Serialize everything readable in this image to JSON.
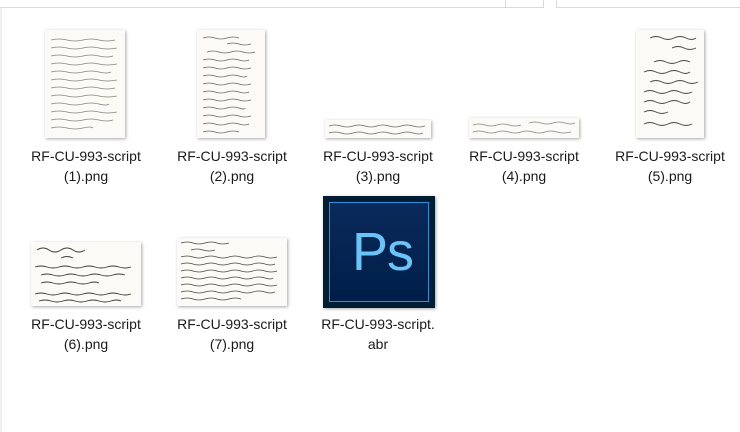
{
  "files": [
    {
      "line1": "RF-CU-993-script",
      "line2": "(1).png",
      "kind": "png"
    },
    {
      "line1": "RF-CU-993-script",
      "line2": "(2).png",
      "kind": "png"
    },
    {
      "line1": "RF-CU-993-script",
      "line2": "(3).png",
      "kind": "png"
    },
    {
      "line1": "RF-CU-993-script",
      "line2": "(4).png",
      "kind": "png"
    },
    {
      "line1": "RF-CU-993-script",
      "line2": "(5).png",
      "kind": "png"
    },
    {
      "line1": "RF-CU-993-script",
      "line2": "(6).png",
      "kind": "png"
    },
    {
      "line1": "RF-CU-993-script",
      "line2": "(7).png",
      "kind": "png"
    },
    {
      "line1": "RF-CU-993-script.",
      "line2": "abr",
      "kind": "abr"
    }
  ],
  "ps_icon_text": "Ps",
  "colors": {
    "ps_background": "#001e47",
    "ps_text": "#6bc4f7",
    "ps_border": "#2f8fd8"
  }
}
